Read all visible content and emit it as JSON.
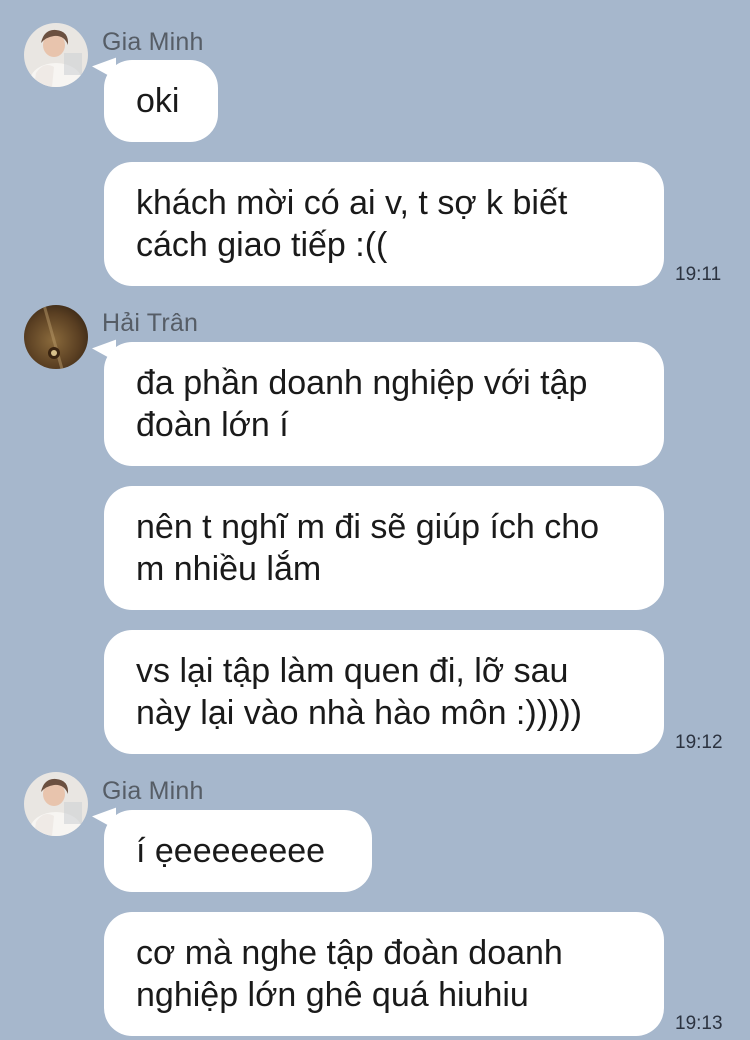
{
  "colors": {
    "background": "#a6b7cc",
    "bubble": "#ffffff",
    "sender_text": "#565d66",
    "time_text": "#2c3340"
  },
  "groups": [
    {
      "sender": "Gia Minh",
      "avatar_icon": "profile-photo-gia-minh",
      "messages": [
        {
          "text": "oki",
          "time": ""
        },
        {
          "text": "khách mời có ai v, t sợ k biết cách giao tiếp :((",
          "time": "19:11"
        }
      ]
    },
    {
      "sender": "Hải Trân",
      "avatar_icon": "profile-photo-hai-tran",
      "messages": [
        {
          "text": "đa phần doanh nghiệp với tập đoàn lớn í",
          "time": ""
        },
        {
          "text": "nên t nghĩ m đi sẽ giúp ích cho m nhiều lắm",
          "time": ""
        },
        {
          "text": "vs lại tập làm quen đi, lỡ sau này lại vào nhà hào môn :)))))",
          "time": "19:12"
        }
      ]
    },
    {
      "sender": "Gia Minh",
      "avatar_icon": "profile-photo-gia-minh",
      "messages": [
        {
          "text": "í ẹeeeeeeee",
          "time": ""
        },
        {
          "text": "cơ mà nghe tập đoàn doanh nghiệp lớn ghê quá hiuhiu",
          "time": "19:13"
        }
      ]
    }
  ]
}
